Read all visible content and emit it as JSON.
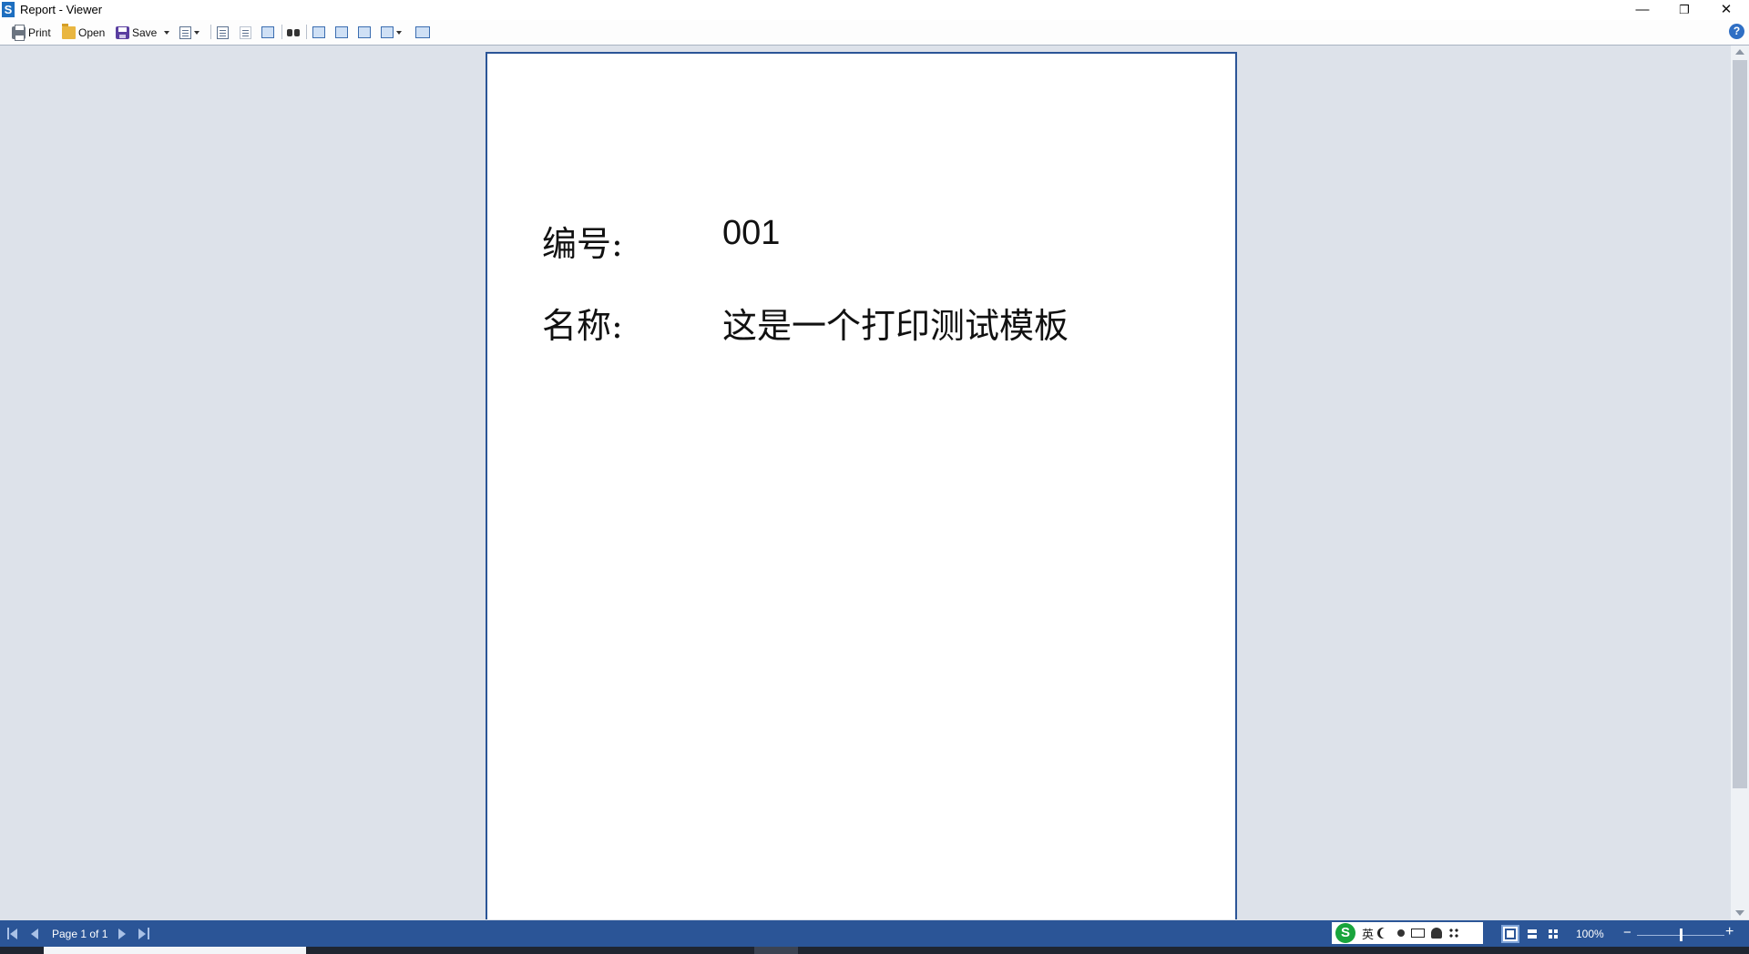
{
  "window": {
    "title": "Report - Viewer",
    "logo_letter": "S",
    "minimize_glyph": "—",
    "restore_glyph": "❐",
    "close_glyph": "✕"
  },
  "toolbar": {
    "print_label": "Print",
    "open_label": "Open",
    "save_label": "Save",
    "help_glyph": "?"
  },
  "report": {
    "fields": [
      {
        "label": "编号:",
        "value": "001"
      },
      {
        "label": "名称:",
        "value": "这是一个打印测试模板"
      }
    ]
  },
  "statusbar": {
    "page_info": "Page 1 of 1",
    "zoom": "100%",
    "zoom_minus": "−",
    "zoom_plus": "+",
    "zoom_level": 0.5
  },
  "ime": {
    "logo": "S",
    "lang": "英"
  },
  "colors": {
    "accent": "#2b5597",
    "canvas": "#dde2ea",
    "page": "#ffffff"
  }
}
